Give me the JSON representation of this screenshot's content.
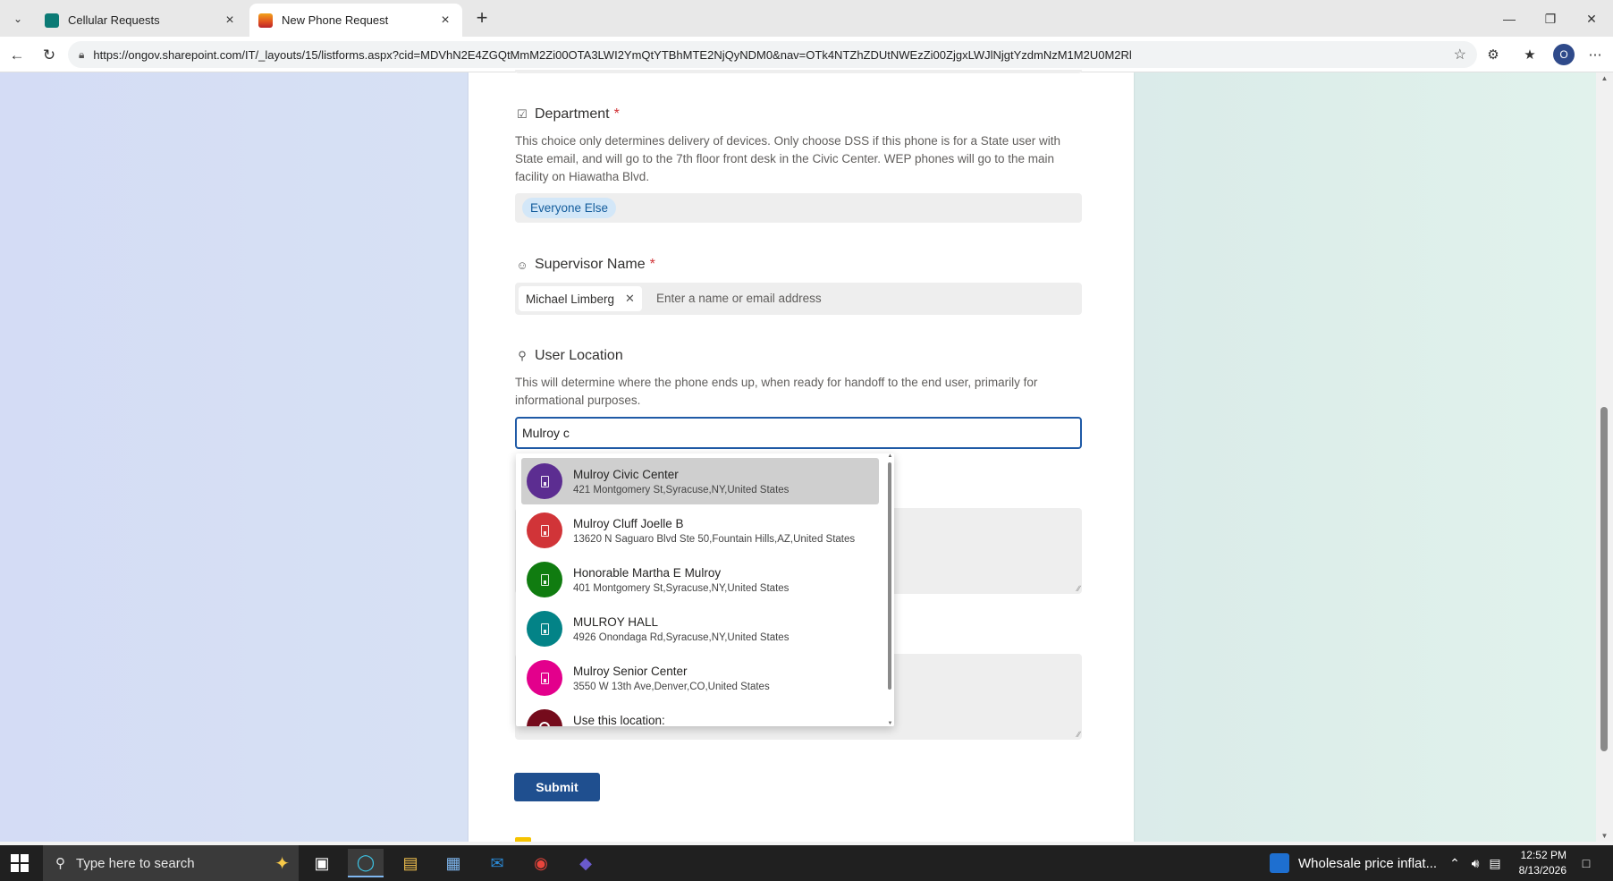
{
  "browser": {
    "tabs": [
      {
        "title": "Cellular Requests",
        "favicon_color": "#0b7a75"
      },
      {
        "title": "New Phone Request",
        "favicon_color": "#d9452b"
      }
    ],
    "url": "https://ongov.sharepoint.com/IT/_layouts/15/listforms.aspx?cid=MDVhN2E4ZGQtMmM2Zi00OTA3LWI2YmQtYTBhMTE2NjQyNDM0&nav=OTk4NTZhZDUtNWEzZi00ZjgxLWJlNjgtYzdmNzM1M2U0M2Rl",
    "profile_initial": "O"
  },
  "form": {
    "department": {
      "label": "Department",
      "required_mark": "*",
      "description": "This choice only determines delivery of devices. Only choose DSS if this phone is for a State user with State email, and will go to the 7th floor front desk in the Civic Center. WEP phones will go to the main facility on Hiawatha Blvd.",
      "value": "Everyone Else"
    },
    "supervisor": {
      "label": "Supervisor Name",
      "required_mark": "*",
      "selected_person": "Michael Limberg",
      "placeholder": "Enter a name or email address"
    },
    "user_location": {
      "label": "User Location",
      "description": "This will determine where the phone ends up, when ready for handoff to the end user, primarily for informational purposes.",
      "value": "Mulroy c",
      "suggestions": [
        {
          "name": "Mulroy Civic Center",
          "address": "421 Montgomery St,Syracuse,NY,United States",
          "color": "#5c2d91"
        },
        {
          "name": "Mulroy Cluff Joelle B",
          "address": "13620 N Saguaro Blvd Ste 50,Fountain Hills,AZ,United States",
          "color": "#d13438"
        },
        {
          "name": "Honorable Martha E Mulroy",
          "address": "401 Montgomery St,Syracuse,NY,United States",
          "color": "#107c10"
        },
        {
          "name": "MULROY HALL",
          "address": "4926 Onondaga Rd,Syracuse,NY,United States",
          "color": "#038387"
        },
        {
          "name": "Mulroy Senior Center",
          "address": "3550 W 13th Ave,Denver,CO,United States",
          "color": "#e3008c"
        },
        {
          "name": "Use this location:",
          "address": "",
          "color": "#750b1c"
        }
      ]
    },
    "submit_label": "Submit"
  },
  "taskbar": {
    "search_placeholder": "Type here to search",
    "news_text": "Wholesale price inflat...",
    "time": "12:52 PM",
    "date": "8/13/2026"
  }
}
